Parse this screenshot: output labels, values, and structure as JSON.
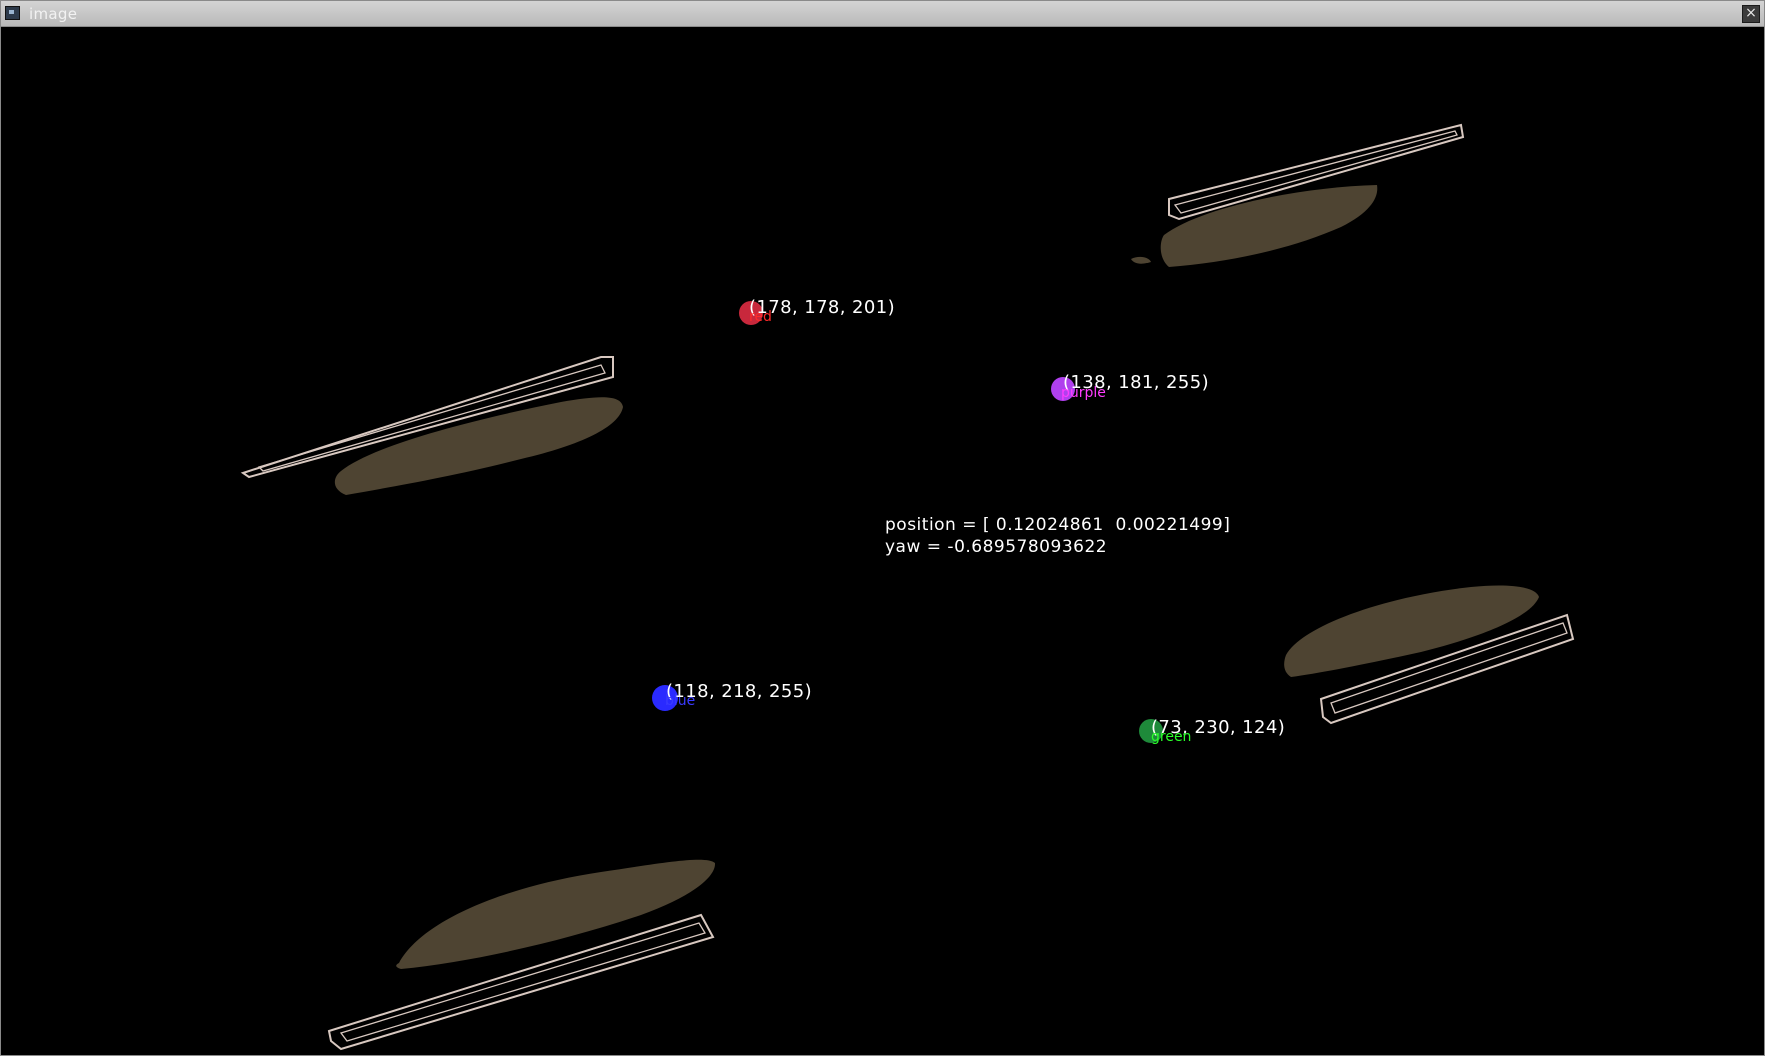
{
  "window": {
    "title": "image",
    "close_label": "×"
  },
  "markers": [
    {
      "rgb_text": "(178, 178, 201)",
      "label": "red",
      "color": "#c8283c"
    },
    {
      "rgb_text": "(138, 181, 255)",
      "label": "purple",
      "color": "#b040ee"
    },
    {
      "rgb_text": "(118, 218, 255)",
      "label": "blue",
      "color": "#2a2aff"
    },
    {
      "rgb_text": "(73, 230, 124)",
      "label": "green",
      "color": "#1e8a3a"
    }
  ],
  "label_colors": {
    "red": "#ff2a2a",
    "purple": "#ff3cff",
    "blue": "#3a3aff",
    "green": "#2aff2a"
  },
  "info": {
    "position_line": "position = [ 0.12024861  0.00221499]",
    "yaw_line": "yaw = -0.689578093622"
  },
  "colors": {
    "background": "#000000",
    "blob_fill": "#4e4432",
    "outline": "#d8c8c0"
  }
}
